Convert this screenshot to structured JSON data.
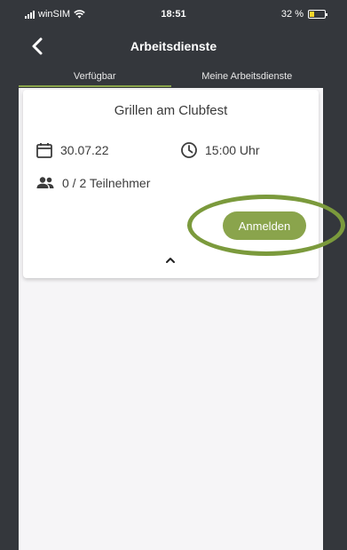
{
  "status_bar": {
    "carrier": "winSIM",
    "time": "18:51",
    "battery_text": "32 %",
    "battery_level": 0.32,
    "battery_color": "#f5d42a"
  },
  "header": {
    "title": "Arbeitsdienste",
    "back_icon": "chevron-left-icon"
  },
  "tabs": [
    {
      "label": "Verfügbar",
      "active": true
    },
    {
      "label": "Meine Arbeitsdienste",
      "active": false
    }
  ],
  "card": {
    "title": "Grillen am Clubfest",
    "date": "30.07.22",
    "time": "15:00 Uhr",
    "participants": "0 / 2 Teilnehmer",
    "register_label": "Anmelden",
    "date_icon": "calendar-icon",
    "time_icon": "clock-icon",
    "participants_icon": "people-icon",
    "collapse_icon": "chevron-up-icon"
  },
  "colors": {
    "accent": "#8aa44c",
    "highlight_ring": "#7b9a3c",
    "background": "#34373c"
  }
}
